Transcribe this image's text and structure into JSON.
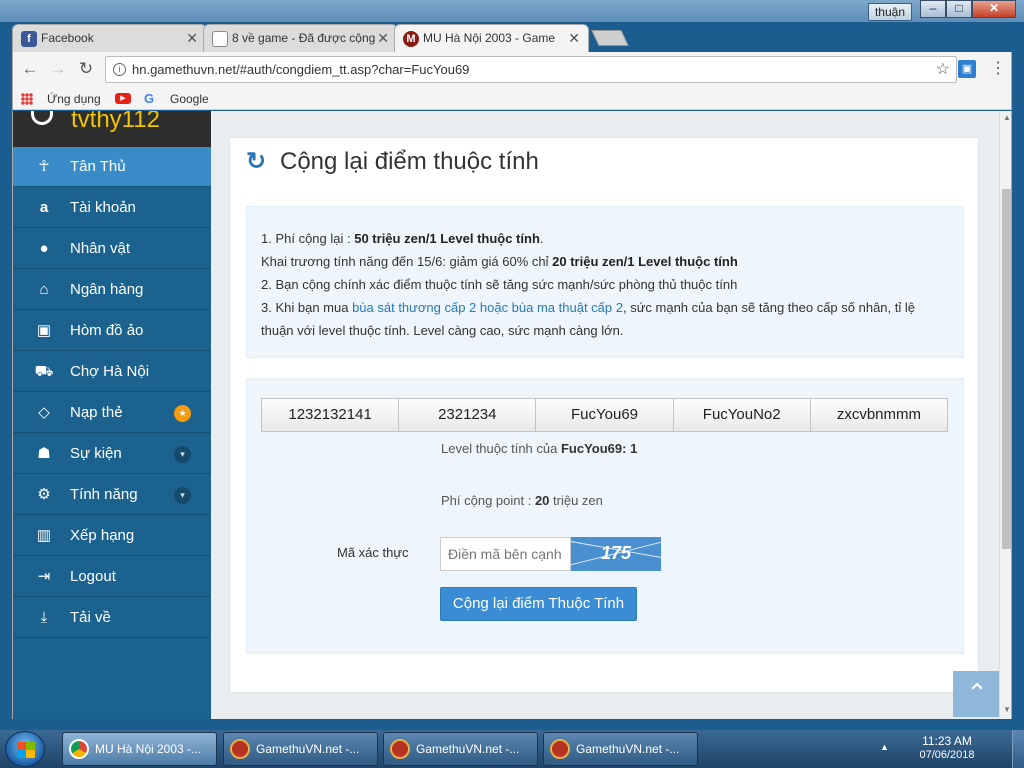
{
  "os": {
    "user": "thuận",
    "minimize": "–",
    "maximize": "□",
    "close": "✕"
  },
  "browser": {
    "tabs": [
      {
        "label": "Facebook",
        "icon": "facebook-icon"
      },
      {
        "label": "8 về game - Đã được cộng",
        "icon": "page-icon"
      },
      {
        "label": "MU Hà Nội 2003 - Game",
        "icon": "mu-icon"
      }
    ],
    "url": "hn.gamethuvn.net/#auth/congdiem_tt.asp?char=FucYou69",
    "bookmarks": {
      "apps": "Ứng dụng",
      "google": "Google"
    }
  },
  "sidebar": {
    "username": "tvthy112",
    "items": [
      {
        "label": "Tân Thủ",
        "icon": "person-icon"
      },
      {
        "label": "Tài khoản",
        "icon": "amazon-icon"
      },
      {
        "label": "Nhân vật",
        "icon": "user-icon"
      },
      {
        "label": "Ngân hàng",
        "icon": "bank-icon"
      },
      {
        "label": "Hòm đồ ảo",
        "icon": "briefcase-icon"
      },
      {
        "label": "Chợ Hà Nội",
        "icon": "cart-icon"
      },
      {
        "label": "Nạp thẻ",
        "icon": "diamond-icon"
      },
      {
        "label": "Sự kiện",
        "icon": "android-icon"
      },
      {
        "label": "Tính năng",
        "icon": "gears-icon"
      },
      {
        "label": "Xếp hạng",
        "icon": "bar-chart-icon"
      },
      {
        "label": "Logout",
        "icon": "logout-icon"
      },
      {
        "label": "Tải về",
        "icon": "download-icon"
      }
    ]
  },
  "page": {
    "title": "Cộng lại điểm thuộc tính",
    "notice": {
      "l1_prefix": "1. Phí cộng lại : ",
      "l1_bold": "50 triệu zen/1 Level thuộc tính",
      "l1_suffix": ".",
      "l2_prefix": "Khai trương tính năng đến 15/6: giảm giá 60% chỉ ",
      "l2_bold": "20 triệu zen/1 Level thuộc tính",
      "l3": "2. Bạn cộng chính xác điểm thuộc tính sẽ tăng sức mạnh/sức phòng thủ thuộc tính",
      "l4_prefix": "3. Khi bạn mua ",
      "l4_link": "bùa sát thương cấp 2 hoặc bùa ma thuật cấp 2",
      "l4_suffix": ", sức mạnh của bạn sẽ tăng theo cấp số nhân, tỉ lệ",
      "l5": "thuận với level thuộc tính. Level càng cao, sức mạnh càng lớn."
    },
    "characters": [
      "1232132141",
      "2321234",
      "FucYou69",
      "FucYouNo2",
      "zxcvbnmmm"
    ],
    "level_prefix": "Level thuộc tính của ",
    "level_char": "FucYou69",
    "level_value": ": 1",
    "fee_prefix": "Phí cộng point : ",
    "fee_bold": "20",
    "fee_suffix": " triệu zen",
    "captcha_label": "Mã xác thực",
    "captcha_placeholder": "Điền mã bên cạnh",
    "captcha_code": "175",
    "submit_label": "Cộng lại điểm Thuộc Tính"
  },
  "taskbar": {
    "items": [
      {
        "label": "MU Hà Nội 2003 -..."
      },
      {
        "label": "GamethuVN.net -..."
      },
      {
        "label": "GamethuVN.net -..."
      },
      {
        "label": "GamethuVN.net -..."
      }
    ],
    "time": "11:23 AM",
    "date": "07/06/2018"
  }
}
